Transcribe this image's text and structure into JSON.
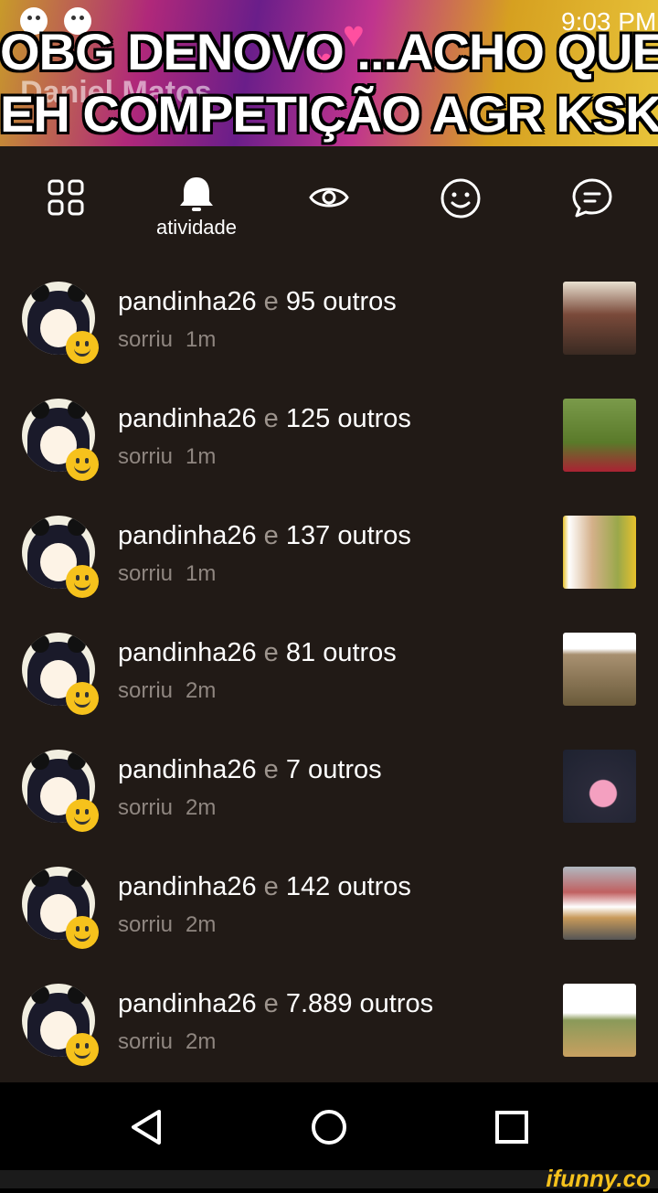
{
  "header": {
    "ghost_text": "Daniel Matos",
    "caption_line1": "OBG DENOVO       ...ACHO QUE",
    "caption_line2": "EH COMPETIÇÃO AGR KSKSK",
    "time": "9:03 PM"
  },
  "tabs": [
    {
      "name": "grid",
      "icon": "grid-icon",
      "label": ""
    },
    {
      "name": "activity",
      "icon": "bell-icon",
      "label": "atividade",
      "active": true
    },
    {
      "name": "views",
      "icon": "eye-icon",
      "label": ""
    },
    {
      "name": "smiles",
      "icon": "smile-icon",
      "label": ""
    },
    {
      "name": "comments",
      "icon": "chat-icon",
      "label": ""
    }
  ],
  "rows": [
    {
      "user": "pandinha26",
      "e": "e",
      "others": "95 outros",
      "action": "sorriu",
      "time": "1m",
      "thumb_color": "#7a4a3a"
    },
    {
      "user": "pandinha26",
      "e": "e",
      "others": "125 outros",
      "action": "sorriu",
      "time": "1m",
      "thumb_color": "#6a8a3a"
    },
    {
      "user": "pandinha26",
      "e": "e",
      "others": "137 outros",
      "action": "sorriu",
      "time": "1m",
      "thumb_color": "#c8a83a"
    },
    {
      "user": "pandinha26",
      "e": "e",
      "others": "81 outros",
      "action": "sorriu",
      "time": "2m",
      "thumb_color": "#8a7a5a"
    },
    {
      "user": "pandinha26",
      "e": "e",
      "others": "7 outros",
      "action": "sorriu",
      "time": "2m",
      "thumb_color": "#2a2a3a"
    },
    {
      "user": "pandinha26",
      "e": "e",
      "others": "142 outros",
      "action": "sorriu",
      "time": "2m",
      "thumb_color": "#8a6a4a"
    },
    {
      "user": "pandinha26",
      "e": "e",
      "others": "7.889 outros",
      "action": "sorriu",
      "time": "2m",
      "thumb_color": "#5a6a3a"
    }
  ],
  "watermark": "ifunny.co",
  "colors": {
    "background": "#211a16",
    "text_secondary": "#8f8680",
    "accent": "#f6c21c"
  }
}
